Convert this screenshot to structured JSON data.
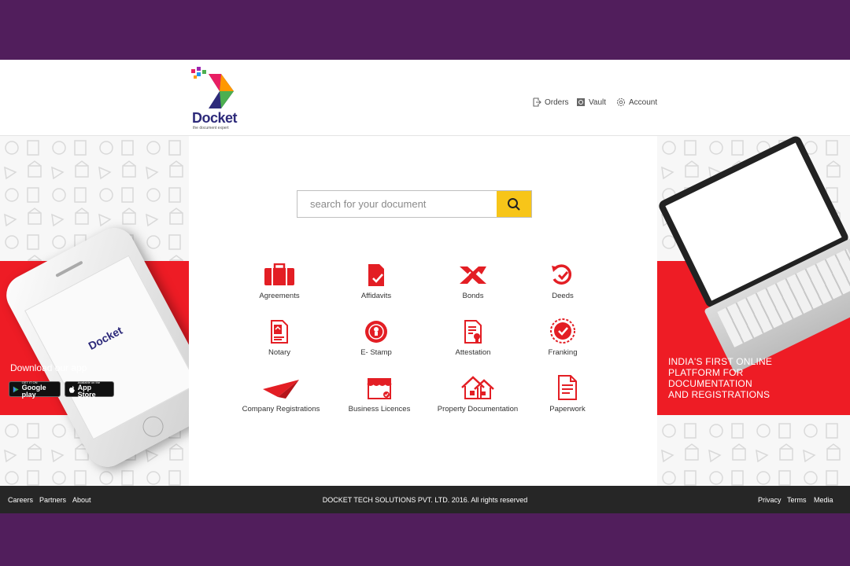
{
  "brand": {
    "name": "Docket",
    "tagline": "the document expert"
  },
  "header": {
    "nav": [
      {
        "label": "Orders",
        "icon": "orders-icon"
      },
      {
        "label": "Vault",
        "icon": "vault-icon"
      },
      {
        "label": "Account",
        "icon": "account-icon"
      }
    ]
  },
  "search": {
    "placeholder": "search for your document",
    "button_icon": "search-icon"
  },
  "categories": [
    {
      "label": "Agreements",
      "icon": "agreements-icon"
    },
    {
      "label": "Affidavits",
      "icon": "affidavits-icon"
    },
    {
      "label": "Bonds",
      "icon": "bonds-icon"
    },
    {
      "label": "Deeds",
      "icon": "deeds-icon"
    },
    {
      "label": "Notary",
      "icon": "notary-icon"
    },
    {
      "label": "E- Stamp",
      "icon": "e-stamp-icon"
    },
    {
      "label": "Attestation",
      "icon": "attestation-icon"
    },
    {
      "label": "Franking",
      "icon": "franking-icon"
    },
    {
      "label": "Company Registrations",
      "icon": "company-registrations-icon"
    },
    {
      "label": "Business Licences",
      "icon": "business-licences-icon"
    },
    {
      "label": "Property Documentation",
      "icon": "property-documentation-icon"
    },
    {
      "label": "Paperwork",
      "icon": "paperwork-icon"
    }
  ],
  "app_promo": {
    "title": "Download our app",
    "google_play": {
      "small": "GET IT ON",
      "label": "Google play"
    },
    "app_store": {
      "small": "Available on the",
      "label": "App Store"
    }
  },
  "platform_promo": {
    "lines": [
      "INDIA'S FIRST ONLINE",
      "PLATFORM FOR",
      "DOCUMENTATION",
      "AND REGISTRATIONS"
    ]
  },
  "footer": {
    "left_links": [
      "Careers",
      "Partners",
      "About"
    ],
    "copyright": "DOCKET TECH SOLUTIONS PVT. LTD. 2016. All rights reserved",
    "right_links": [
      "Privacy",
      "Terms",
      "Media"
    ]
  },
  "colors": {
    "frame": "#511e5c",
    "accent_red": "#ee1c25",
    "search_yellow": "#f7c519",
    "footer": "#262626"
  }
}
